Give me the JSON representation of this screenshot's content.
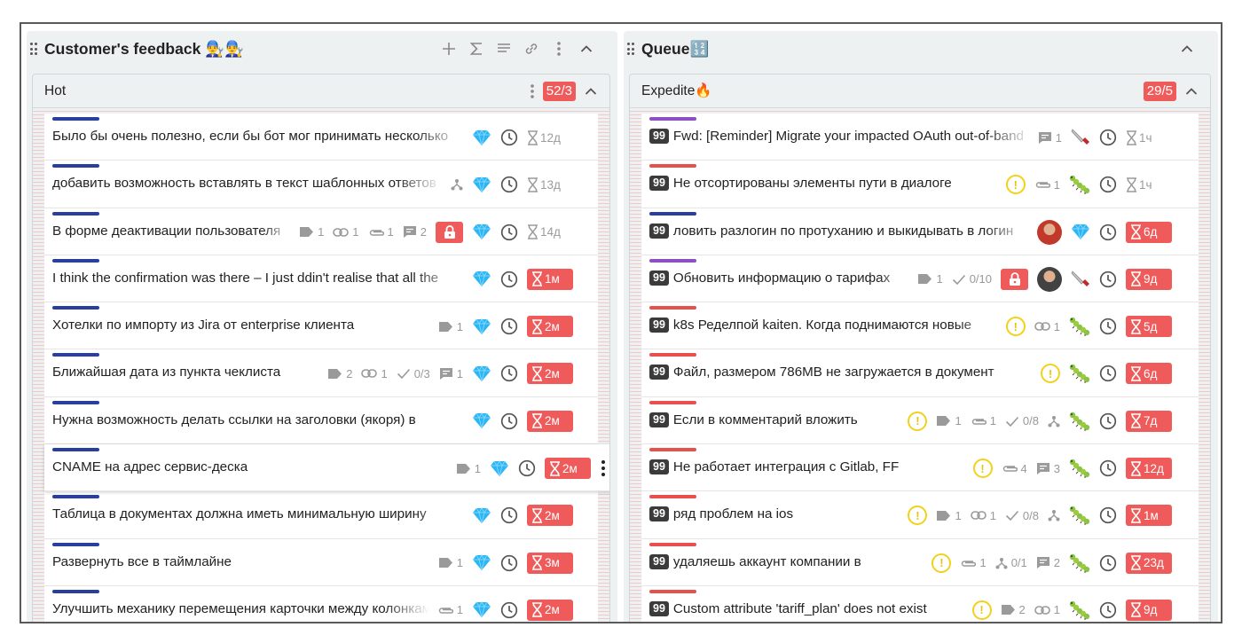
{
  "columns": [
    {
      "title": "Customer's feedback 👨‍🔧👨‍🔧",
      "lane": {
        "title": "Hot",
        "count": "52/3"
      },
      "cards": [
        {
          "title": "Было бы очень полезно, если бы бот мог принимать несколько",
          "bar": "#2a3ea0",
          "due": "12д",
          "overdue": false
        },
        {
          "title": "добавить возможность вставлять в текст шаблонных ответов",
          "bar": "#2a3ea0",
          "due": "13д",
          "overdue": false
        },
        {
          "title": "В форме деактивации пользователя",
          "bar": "#2a3ea0",
          "tags": "1",
          "links": "1",
          "files": "1",
          "comments": "2",
          "due": "14д",
          "overdue": false
        },
        {
          "title": "I think the confirmation was there – I just ddin't realise that all the",
          "bar": "#2a3ea0",
          "due": "1м",
          "overdue": true
        },
        {
          "title": "Хотелки по импорту из Jira от enterprise клиента",
          "bar": "#2a3ea0",
          "tags": "1",
          "due": "2м",
          "overdue": true
        },
        {
          "title": "Ближайшая дата из пункта чеклиста",
          "bar": "#2a3ea0",
          "tags": "2",
          "links": "1",
          "checklist": "0/3",
          "comments": "1",
          "due": "2м",
          "overdue": true
        },
        {
          "title": "Нужна возможность делать ссылки на заголовки (якоря) в",
          "bar": "#2a3ea0",
          "due": "2м",
          "overdue": true
        },
        {
          "title": "CNAME на адрес сервис-деска",
          "bar": "#2a3ea0",
          "tags": "1",
          "due": "2м",
          "overdue": true
        },
        {
          "title": "Таблица в документах должна иметь минимальную ширину",
          "bar": "#2a3ea0",
          "due": "2м",
          "overdue": true
        },
        {
          "title": "Развернуть все в таймлайне",
          "bar": "#2a3ea0",
          "tags": "1",
          "due": "3м",
          "overdue": true
        },
        {
          "title": "Улучшить механику перемещения карточки между колонками",
          "bar": "#2a3ea0",
          "files": "1",
          "due": "2м",
          "overdue": true
        }
      ]
    },
    {
      "title": "Queue🔢",
      "lane": {
        "title": "Expedite🔥",
        "count": "29/5"
      },
      "cards": [
        {
          "priority": "99",
          "title": "Fwd: [Reminder] Migrate your impacted OAuth out-of-band",
          "bar": "#8c4fc4",
          "comments": "1",
          "due": "1ч",
          "overdue": false
        },
        {
          "priority": "99",
          "title": "Не отсортированы элементы пути в диалоге",
          "bar": "#e85050",
          "files": "1",
          "due": "1ч",
          "overdue": false
        },
        {
          "priority": "99",
          "title": "ловить разлогин по протуханию и выкидывать в логин",
          "bar": "#2a3ea0",
          "due": "6д",
          "overdue": true
        },
        {
          "priority": "99",
          "title": "Обновить информацию о тарифах",
          "bar": "#8c4fc4",
          "tags": "1",
          "checklist": "0/10",
          "due": "9д",
          "overdue": true
        },
        {
          "priority": "99",
          "title": "k8s Ределпой kaiten. Когда поднимаются новые",
          "bar": "#e85050",
          "links": "1",
          "due": "5д",
          "overdue": true
        },
        {
          "priority": "99",
          "title": "Файл, размером 786MB не загружается в документ",
          "bar": "#e85050",
          "due": "6д",
          "overdue": true
        },
        {
          "priority": "99",
          "title": "Если в комментарий вложить",
          "bar": "#e85050",
          "tags": "1",
          "files": "1",
          "checklist": "0/8",
          "due": "7д",
          "overdue": true
        },
        {
          "priority": "99",
          "title": "Не работает интеграция с Gitlab, FF",
          "bar": "#e85050",
          "files": "4",
          "comments": "3",
          "due": "12д",
          "overdue": true
        },
        {
          "priority": "99",
          "title": "ряд проблем на ios",
          "bar": "#e85050",
          "tags": "1",
          "links": "1",
          "checklist": "0/8",
          "due": "1м",
          "overdue": true
        },
        {
          "priority": "99",
          "title": "удаляешь аккаунт компании в",
          "bar": "#e85050",
          "files": "1",
          "subtasks": "0/1",
          "comments": "2",
          "due": "23д",
          "overdue": true
        },
        {
          "priority": "99",
          "title": "Custom attribute 'tariff_plan' does not exist",
          "bar": "#e85050",
          "tags": "2",
          "links": "1",
          "due": "9д",
          "overdue": true
        }
      ]
    }
  ]
}
